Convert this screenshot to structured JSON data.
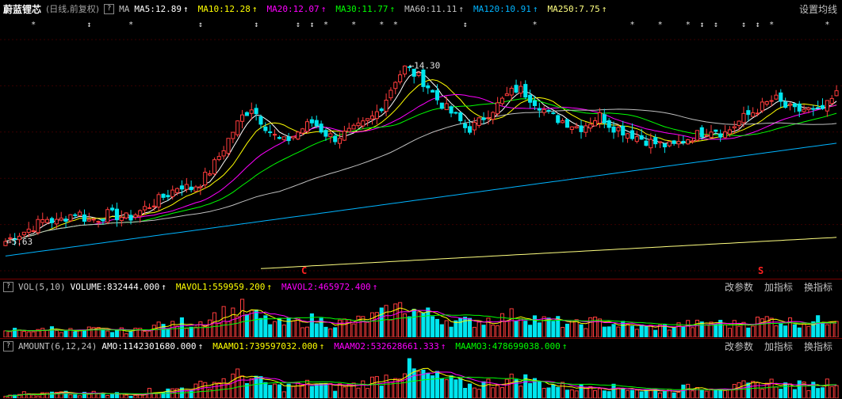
{
  "stock_name": "蔚蓝锂芯",
  "period": "(日线,前复权)",
  "ma_prefix": "MA",
  "ma_items": [
    {
      "text": "MA5:12.89",
      "color": "#ffffff"
    },
    {
      "text": "MA10:12.28",
      "color": "#ffff00"
    },
    {
      "text": "MA20:12.07",
      "color": "#ff00ff"
    },
    {
      "text": "MA30:11.77",
      "color": "#00ff00"
    },
    {
      "text": "MA60:11.11",
      "color": "#c0c0c0"
    },
    {
      "text": "MA120:10.91",
      "color": "#00b4ff"
    },
    {
      "text": "MA250:7.75",
      "color": "#ffff80"
    }
  ],
  "set_ma_label": "设置均线",
  "vol_label": "VOL(5,10)",
  "vol_items": [
    {
      "text": "VOLUME:832444.000",
      "color": "#ffffff"
    },
    {
      "text": "MAVOL1:559959.200",
      "color": "#ffff00"
    },
    {
      "text": "MAVOL2:465972.400",
      "color": "#ff00ff"
    }
  ],
  "amount_label": "AMOUNT(6,12,24)",
  "amount_items": [
    {
      "text": "AMO:1142301680.000",
      "color": "#ffffff"
    },
    {
      "text": "MAAMO1:739597032.000",
      "color": "#ffff00"
    },
    {
      "text": "MAAMO2:532628661.333",
      "color": "#ff00ff"
    },
    {
      "text": "MAAMO3:478699038.000",
      "color": "#00ff00"
    }
  ],
  "panel_buttons": [
    "改参数",
    "加指标",
    "换指标"
  ],
  "signals": [
    {
      "label": "C",
      "color": "#ff2020"
    },
    {
      "label": "S",
      "color": "#ff2020"
    }
  ],
  "chart_data": {
    "type": "candlestick",
    "price_range": [
      4.5,
      15.5
    ],
    "high_label": "14.30",
    "low_label": "5.63",
    "up_color": "#ff3c3c",
    "down_color": "#00e5ee",
    "close_path": [
      5.9,
      6.2,
      6.4,
      6.7,
      7.0,
      6.8,
      7.1,
      7.3,
      6.9,
      7.0,
      7.2,
      7.1,
      7.0,
      7.3,
      7.6,
      7.9,
      8.2,
      8.6,
      8.4,
      8.7,
      9.3,
      10.1,
      11.0,
      11.8,
      12.3,
      11.6,
      11.0,
      10.6,
      10.9,
      11.3,
      11.6,
      11.1,
      10.8,
      11.0,
      11.2,
      11.5,
      11.9,
      12.6,
      13.6,
      14.2,
      13.8,
      13.4,
      12.7,
      12.2,
      11.8,
      11.2,
      11.5,
      12.0,
      12.4,
      12.9,
      13.2,
      12.8,
      12.4,
      11.9,
      11.7,
      11.5,
      11.3,
      11.6,
      11.9,
      11.4,
      11.2,
      11.0,
      10.8,
      10.6,
      10.5,
      10.4,
      10.7,
      10.9,
      11.1,
      11.3,
      11.0,
      11.4,
      11.8,
      12.1,
      12.4,
      12.7,
      12.3,
      12.1,
      12.2,
      12.0,
      12.3,
      12.9
    ],
    "ma_lines": [
      {
        "name": "MA5",
        "color": "#ffffff",
        "period": 5
      },
      {
        "name": "MA10",
        "color": "#ffff00",
        "period": 10
      },
      {
        "name": "MA20",
        "color": "#ff00ff",
        "period": 20
      },
      {
        "name": "MA30",
        "color": "#00ff00",
        "period": 30
      },
      {
        "name": "MA60",
        "color": "#c0c0c0",
        "period": 60
      },
      {
        "name": "MA120",
        "color": "#00b4ff",
        "period": 120
      },
      {
        "name": "MA250",
        "color": "#ffff80",
        "period": 250
      }
    ],
    "volume_path": [
      2,
      3,
      3,
      2,
      4,
      3,
      3,
      2,
      3,
      3,
      2,
      3,
      2,
      3,
      4,
      5,
      4,
      6,
      5,
      6,
      8,
      9,
      10,
      11,
      9,
      7,
      6,
      5,
      6,
      6,
      7,
      6,
      5,
      6,
      6,
      7,
      8,
      9,
      11,
      12,
      10,
      9,
      8,
      7,
      6,
      6,
      6,
      7,
      7,
      8,
      9,
      8,
      7,
      6,
      6,
      5,
      5,
      6,
      6,
      5,
      5,
      4,
      4,
      4,
      4,
      4,
      5,
      5,
      5,
      6,
      5,
      5,
      6,
      6,
      7,
      7,
      6,
      6,
      6,
      6,
      7,
      9
    ],
    "amount_path": [
      1,
      2,
      2,
      1,
      2,
      2,
      2,
      1,
      2,
      2,
      1,
      2,
      1,
      2,
      3,
      3,
      3,
      4,
      4,
      5,
      6,
      7,
      8,
      9,
      8,
      6,
      5,
      4,
      5,
      5,
      6,
      5,
      4,
      5,
      5,
      6,
      7,
      8,
      10,
      12,
      10,
      9,
      8,
      7,
      6,
      5,
      5,
      6,
      6,
      7,
      8,
      7,
      6,
      5,
      5,
      4,
      4,
      5,
      5,
      4,
      4,
      4,
      3,
      3,
      3,
      3,
      4,
      4,
      4,
      5,
      4,
      4,
      5,
      5,
      6,
      6,
      5,
      5,
      5,
      5,
      6,
      8
    ]
  }
}
